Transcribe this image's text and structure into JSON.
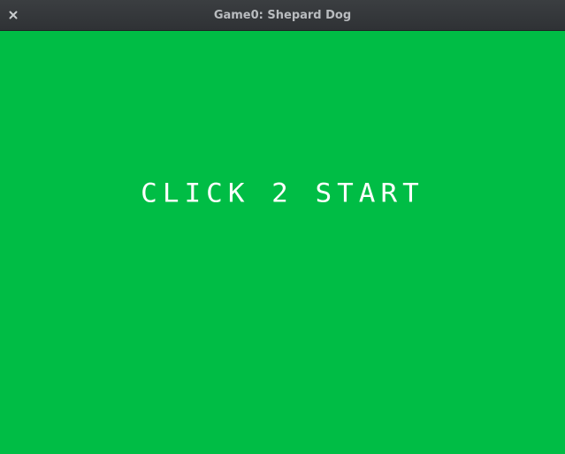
{
  "window": {
    "title": "Game0: Shepard Dog",
    "close_icon": "close-icon"
  },
  "colors": {
    "background": "#00bd45",
    "text": "#ffffff",
    "titlebar": "#34373a"
  },
  "game": {
    "prompt": "CLICK 2 START"
  }
}
